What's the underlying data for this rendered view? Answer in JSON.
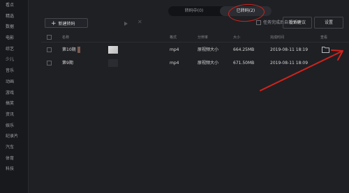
{
  "sidebar": {
    "items": [
      "看点",
      "精选",
      "数据",
      "电影",
      "综艺",
      "少儿",
      "音乐",
      "动画",
      "游戏",
      "搞笑",
      "资讯",
      "娱乐",
      "纪录片",
      "汽车",
      "体育",
      "科技"
    ]
  },
  "tabs": {
    "running": "转码中(0)",
    "done": "已转码(2)"
  },
  "toolbar": {
    "new_label": "新建转码",
    "auto_shutdown": "任务完成后自动关机",
    "feedback": "投诉建议",
    "settings": "设置"
  },
  "table": {
    "headers": {
      "name": "名称",
      "format": "格式",
      "resolution": "分辨率",
      "size": "大小",
      "time": "完成时间",
      "action": "查看"
    },
    "rows": [
      {
        "name": "第10期",
        "format": "mp4",
        "resolution": "原视频大小",
        "size": "664.25MB",
        "time": "2019-08-11 18:19"
      },
      {
        "name": "第9期",
        "format": "mp4",
        "resolution": "原视频大小",
        "size": "671.50MB",
        "time": "2019-08-11 18:09"
      }
    ]
  },
  "colors": {
    "annotation": "#d0231c",
    "background": "#1f2024",
    "sidebar": "#18191c"
  },
  "icons": {
    "new": "plus-icon",
    "start": "play-icon",
    "stop": "close-icon",
    "open": "folder-icon"
  }
}
